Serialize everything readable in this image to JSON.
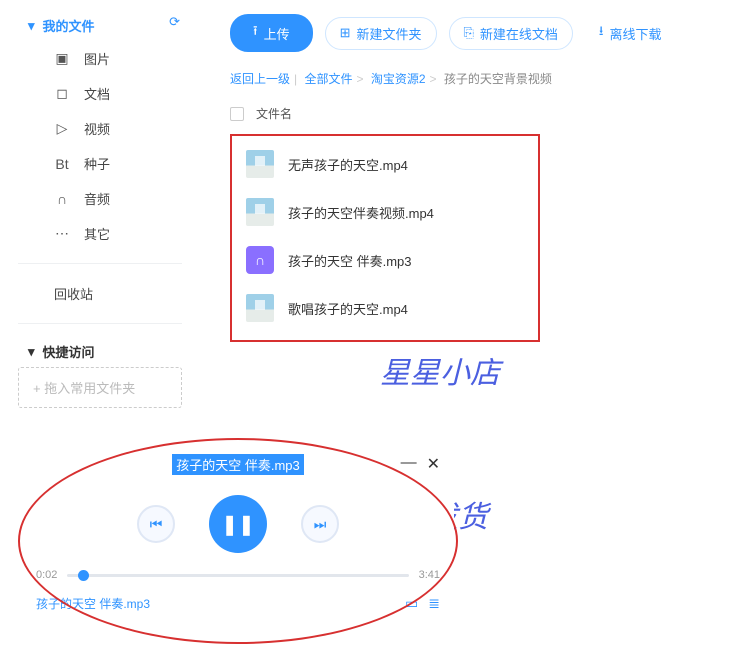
{
  "sidebar": {
    "my_files": "我的文件",
    "items": [
      {
        "icon": "▣",
        "label": "图片"
      },
      {
        "icon": "◻",
        "label": "文档"
      },
      {
        "icon": "▷",
        "label": "视频"
      },
      {
        "icon": "Bt",
        "label": "种子"
      },
      {
        "icon": "∩",
        "label": "音频"
      },
      {
        "icon": "⋯",
        "label": "其它"
      }
    ],
    "recycle": "回收站",
    "quick": "快捷访问",
    "drop": "+ 拖入常用文件夹"
  },
  "toolbar": {
    "upload": "上传",
    "new_folder": "新建文件夹",
    "new_doc": "新建在线文档",
    "offline": "离线下载"
  },
  "crumbs": {
    "back": "返回上一级",
    "all": "全部文件",
    "seg1": "淘宝资源2",
    "cur": "孩子的天空背景视频"
  },
  "col_head": "文件名",
  "files": [
    {
      "type": "video",
      "name": "无声孩子的天空.mp4"
    },
    {
      "type": "video",
      "name": "孩子的天空伴奏视频.mp4"
    },
    {
      "type": "audio",
      "name": "孩子的天空 伴奏.mp3"
    },
    {
      "type": "video",
      "name": "歌唱孩子的天空.mp4"
    }
  ],
  "watermark": {
    "shop": "星星小店",
    "auto": "自动发货"
  },
  "player": {
    "title": "孩子的天空 伴奏.mp3",
    "elapsed": "0:02",
    "total": "3:41",
    "now_playing": "孩子的天空 伴奏.mp3"
  }
}
